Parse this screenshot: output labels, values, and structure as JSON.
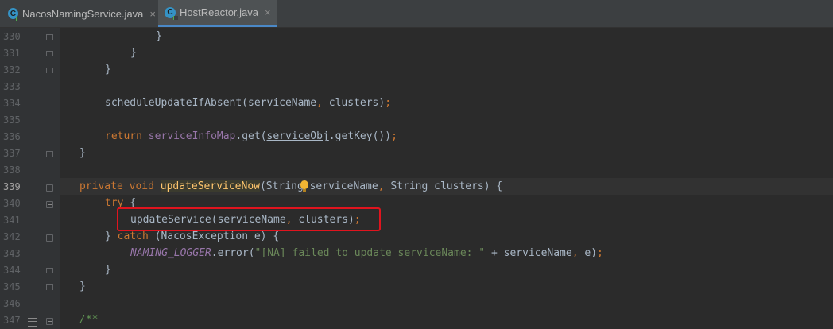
{
  "tabs": [
    {
      "label": "NacosNamingService.java",
      "icon": "java-class-icon",
      "close": "×",
      "active": false
    },
    {
      "label": "HostReactor.java",
      "icon": "java-class-icon",
      "close": "×",
      "active": true
    }
  ],
  "class_icon_glyph": "C",
  "line_numbers": [
    "330",
    "331",
    "332",
    "333",
    "334",
    "335",
    "336",
    "337",
    "338",
    "339",
    "340",
    "341",
    "342",
    "343",
    "344",
    "345",
    "346",
    "347"
  ],
  "current_line": "339",
  "code": {
    "l330": "}",
    "l331": "}",
    "l332": "}",
    "l334_call": "scheduleUpdateIfAbsent(serviceName",
    "l334_comma": ",",
    "l334_rest": " clusters)",
    "l334_semi": ";",
    "l336_kw": "return",
    "l336_field": "serviceInfoMap",
    "l336_mid": ".get(",
    "l336_var": "serviceObj",
    "l336_end": ".getKey())",
    "l336_semi": ";",
    "l337": "}",
    "l339_kw": "private void",
    "l339_name": "updateServiceNow",
    "l339_params_a": "(String",
    "l339_params_b": " serviceName",
    "l339_comma": ",",
    "l339_params_c": " String clusters) {",
    "l340_kw": "try",
    "l340_brace": " {",
    "l341_call": "updateService(serviceName",
    "l341_comma": ",",
    "l341_rest": " clusters)",
    "l341_semi": ";",
    "l342_close": "} ",
    "l342_kw": "catch",
    "l342_rest": " (NacosException e) {",
    "l343_const": "NAMING_LOGGER",
    "l343_mid": ".error(",
    "l343_str": "\"[NA] failed to update serviceName: \"",
    "l343_rest": " + serviceName",
    "l343_comma": ",",
    "l343_end": " e)",
    "l343_semi": ";",
    "l344": "}",
    "l345": "}",
    "l347": "/**"
  },
  "colors": {
    "background": "#2b2b2b",
    "keyword": "#cc7832",
    "method_decl": "#ffc66d",
    "field": "#9876aa",
    "string": "#6a8759",
    "highlight_box": "#e0141e"
  }
}
